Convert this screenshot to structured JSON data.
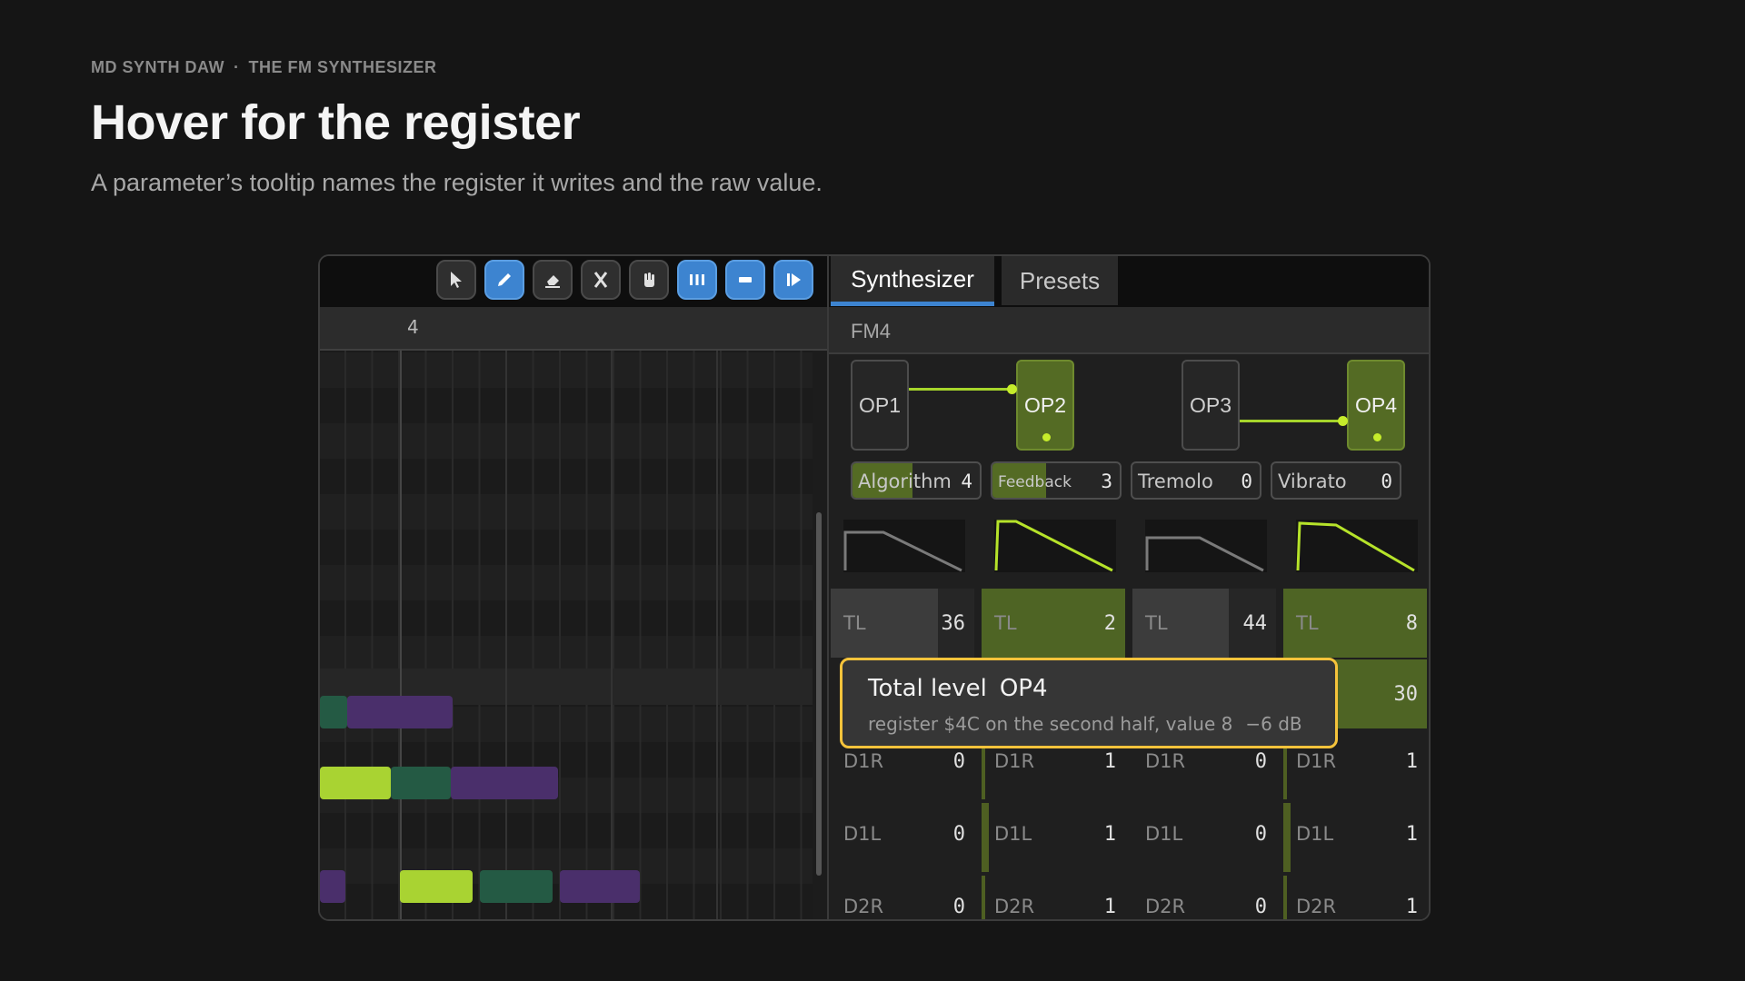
{
  "header": {
    "eyebrow_left": "MD SYNTH DAW",
    "eyebrow_sep": "·",
    "eyebrow_right": "THE FM SYNTHESIZER",
    "title": "Hover for the register",
    "subtitle": "A parameter’s tooltip names the register it writes and the raw value."
  },
  "toolbar": {
    "tools": [
      {
        "icon": "pointer-icon",
        "active": false
      },
      {
        "icon": "pencil-icon",
        "active": true
      },
      {
        "icon": "eraser-icon",
        "active": false
      },
      {
        "icon": "scissors-icon",
        "active": false
      },
      {
        "icon": "hand-icon",
        "active": false
      },
      {
        "icon": "grid-snap-icon",
        "active": true
      },
      {
        "icon": "loop-icon",
        "active": true
      },
      {
        "icon": "play-from-icon",
        "active": true
      }
    ]
  },
  "ruler": {
    "bar_label": "4"
  },
  "tabs": {
    "synth": "Synthesizer",
    "presets": "Presets"
  },
  "channel": {
    "name": "FM4"
  },
  "operators": [
    {
      "label": "OP1",
      "carrier": false
    },
    {
      "label": "OP2",
      "carrier": true
    },
    {
      "label": "OP3",
      "carrier": false
    },
    {
      "label": "OP4",
      "carrier": true
    }
  ],
  "params": [
    {
      "label": "Algorithm",
      "value": "4",
      "level": 0.47
    },
    {
      "label": "Feedback",
      "value": "3",
      "level": 0.42
    },
    {
      "label": "Tremolo",
      "value": "0",
      "level": 0
    },
    {
      "label": "Vibrato",
      "value": "0",
      "level": 0
    }
  ],
  "columns": [
    {
      "tl": "36",
      "ar": "",
      "d1r": "0",
      "d1l": "0",
      "d2r": "0",
      "active": false
    },
    {
      "tl": "2",
      "ar": "",
      "d1r": "1",
      "d1l": "1",
      "d2r": "1",
      "active": true
    },
    {
      "tl": "44",
      "ar": "",
      "d1r": "0",
      "d1l": "0",
      "d2r": "0",
      "active": false
    },
    {
      "tl": "8",
      "ar": "30",
      "d1r": "1",
      "d1l": "1",
      "d2r": "1",
      "active": true
    }
  ],
  "row_labels": {
    "tl": "TL",
    "d1r": "D1R",
    "d1l": "D1L",
    "d2r": "D2R"
  },
  "tooltip": {
    "name": "Total level",
    "operator": "OP4",
    "detail": "register $4C on the second half, value 8",
    "db": "−6 dB"
  },
  "colors": {
    "accent_blue": "#3d84d0",
    "accent_green": "#c6ec2b",
    "active_fill": "#546b24",
    "tooltip_border": "#f5c33b",
    "note_purple": "#4a2f6b",
    "note_teal": "#245a44",
    "note_lime": "#a9d332"
  }
}
